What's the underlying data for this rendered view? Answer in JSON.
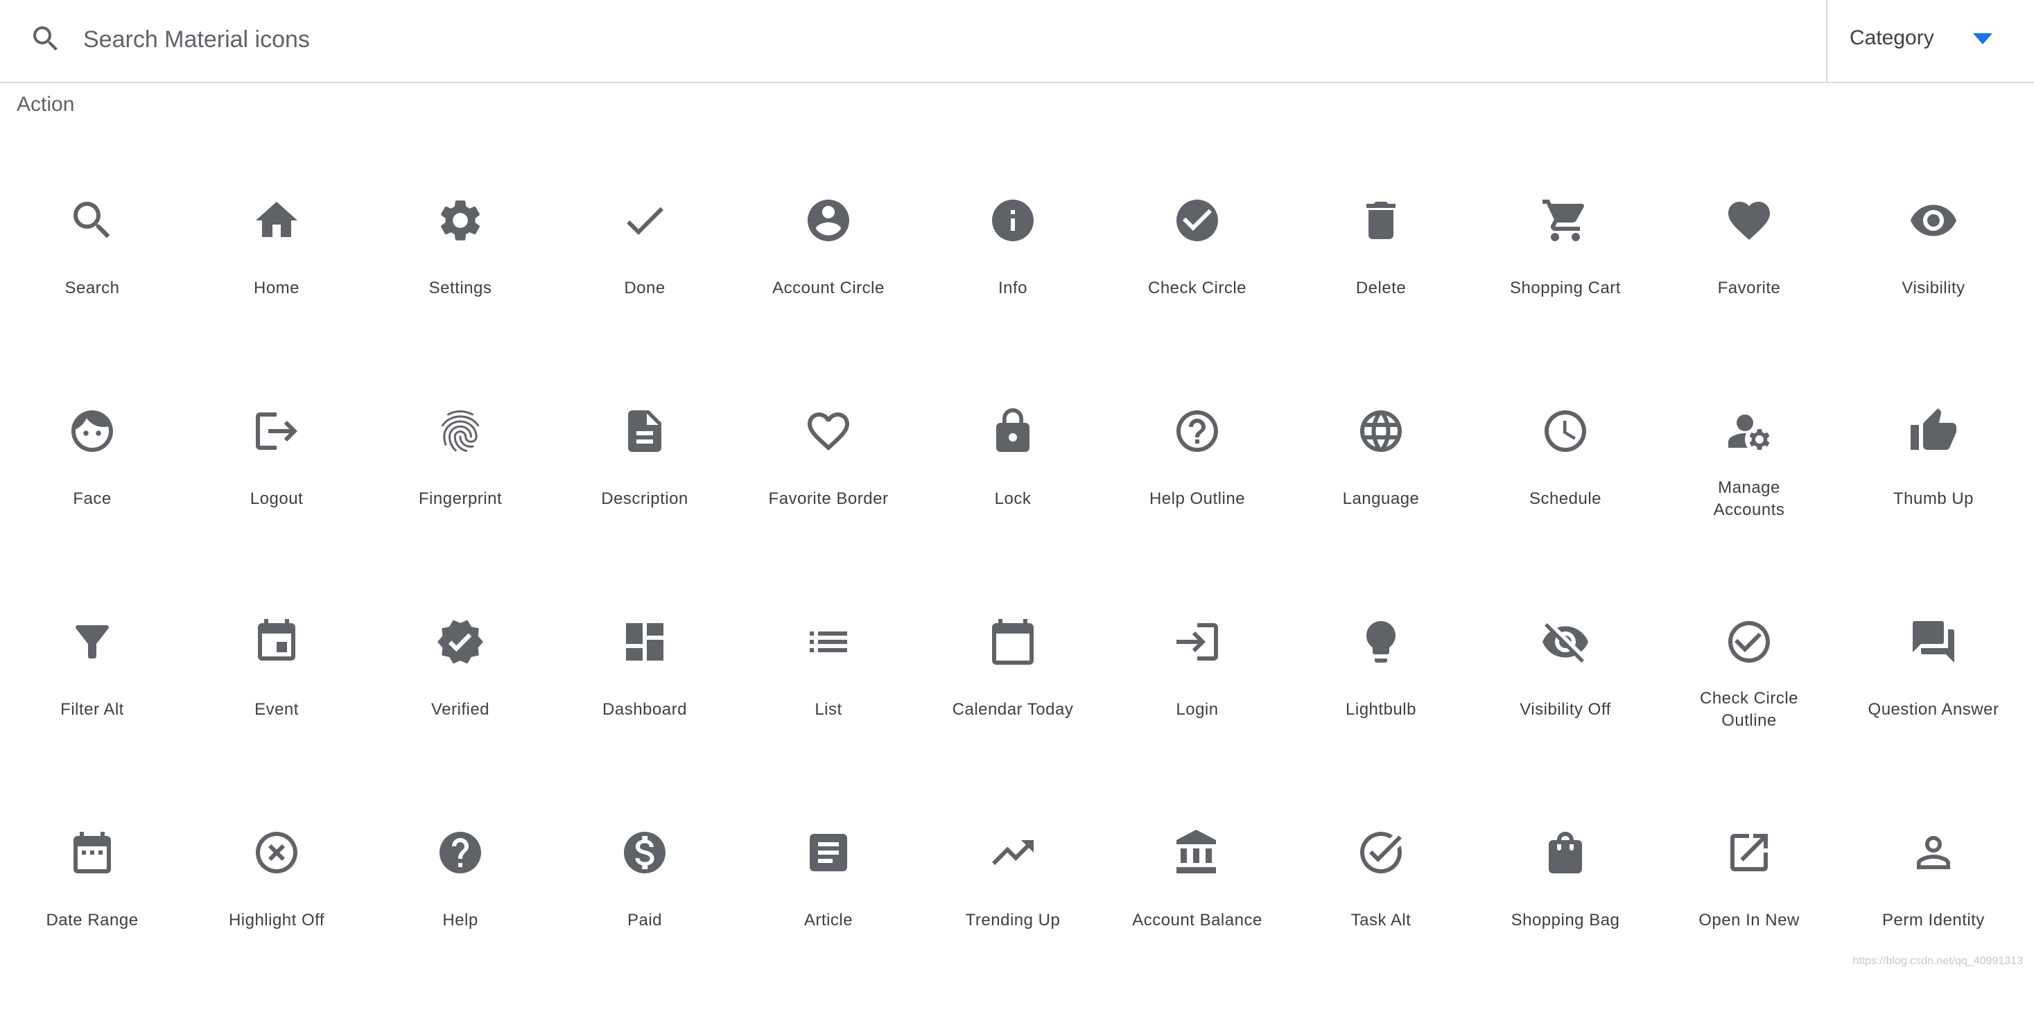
{
  "search": {
    "placeholder": "Search Material icons",
    "icon": "search-icon"
  },
  "category": {
    "label": "Category",
    "icon": "arrow-drop-down-icon",
    "accent": "#1a73e8"
  },
  "section": {
    "title": "Action"
  },
  "colors": {
    "icon": "#5f6368",
    "label": "#3c4043",
    "divider": "#dadce0"
  },
  "icons": [
    {
      "label": "Search",
      "icon": "search"
    },
    {
      "label": "Home",
      "icon": "home"
    },
    {
      "label": "Settings",
      "icon": "settings"
    },
    {
      "label": "Done",
      "icon": "done"
    },
    {
      "label": "Account Circle",
      "icon": "account_circle"
    },
    {
      "label": "Info",
      "icon": "info"
    },
    {
      "label": "Check Circle",
      "icon": "check_circle"
    },
    {
      "label": "Delete",
      "icon": "delete"
    },
    {
      "label": "Shopping Cart",
      "icon": "shopping_cart"
    },
    {
      "label": "Favorite",
      "icon": "favorite"
    },
    {
      "label": "Visibility",
      "icon": "visibility"
    },
    {
      "label": "Face",
      "icon": "face"
    },
    {
      "label": "Logout",
      "icon": "logout"
    },
    {
      "label": "Fingerprint",
      "icon": "fingerprint"
    },
    {
      "label": "Description",
      "icon": "description"
    },
    {
      "label": "Favorite Border",
      "icon": "favorite_border"
    },
    {
      "label": "Lock",
      "icon": "lock"
    },
    {
      "label": "Help Outline",
      "icon": "help_outline"
    },
    {
      "label": "Language",
      "icon": "language"
    },
    {
      "label": "Schedule",
      "icon": "schedule"
    },
    {
      "label": "Manage Accounts",
      "icon": "manage_accounts"
    },
    {
      "label": "Thumb Up",
      "icon": "thumb_up"
    },
    {
      "label": "Filter Alt",
      "icon": "filter_alt"
    },
    {
      "label": "Event",
      "icon": "event"
    },
    {
      "label": "Verified",
      "icon": "verified"
    },
    {
      "label": "Dashboard",
      "icon": "dashboard"
    },
    {
      "label": "List",
      "icon": "list"
    },
    {
      "label": "Calendar Today",
      "icon": "calendar_today"
    },
    {
      "label": "Login",
      "icon": "login"
    },
    {
      "label": "Lightbulb",
      "icon": "lightbulb"
    },
    {
      "label": "Visibility Off",
      "icon": "visibility_off"
    },
    {
      "label": "Check Circle Outline",
      "icon": "check_circle_outline"
    },
    {
      "label": "Question Answer",
      "icon": "question_answer"
    },
    {
      "label": "Date Range",
      "icon": "date_range"
    },
    {
      "label": "Highlight Off",
      "icon": "highlight_off"
    },
    {
      "label": "Help",
      "icon": "help"
    },
    {
      "label": "Paid",
      "icon": "paid"
    },
    {
      "label": "Article",
      "icon": "article"
    },
    {
      "label": "Trending Up",
      "icon": "trending_up"
    },
    {
      "label": "Account Balance",
      "icon": "account_balance"
    },
    {
      "label": "Task Alt",
      "icon": "task_alt"
    },
    {
      "label": "Shopping Bag",
      "icon": "shopping_bag"
    },
    {
      "label": "Open In New",
      "icon": "open_in_new"
    },
    {
      "label": "Perm Identity",
      "icon": "perm_identity"
    }
  ],
  "watermark": "https://blog.csdn.net/qq_40991313"
}
